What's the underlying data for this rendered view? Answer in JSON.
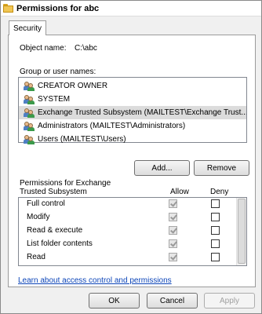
{
  "window": {
    "title": "Permissions for abc"
  },
  "tab": {
    "label": "Security"
  },
  "object": {
    "label": "Object name:",
    "value": "C:\\abc"
  },
  "group": {
    "label": "Group or user names:",
    "users": [
      {
        "name": "CREATOR OWNER"
      },
      {
        "name": "SYSTEM"
      },
      {
        "name": "Exchange Trusted Subsystem (MAILTEST\\Exchange Trust..."
      },
      {
        "name": "Administrators (MAILTEST\\Administrators)"
      },
      {
        "name": "Users (MAILTEST\\Users)"
      }
    ],
    "selected_index": 2
  },
  "buttons": {
    "add": "Add...",
    "remove": "Remove",
    "ok": "OK",
    "cancel": "Cancel",
    "apply": "Apply"
  },
  "permissions": {
    "label_line1": "Permissions for Exchange",
    "label_line2": "Trusted Subsystem",
    "allow_header": "Allow",
    "deny_header": "Deny",
    "rows": [
      {
        "name": "Full control",
        "allow": true,
        "deny": false
      },
      {
        "name": "Modify",
        "allow": true,
        "deny": false
      },
      {
        "name": "Read & execute",
        "allow": true,
        "deny": false
      },
      {
        "name": "List folder contents",
        "allow": true,
        "deny": false
      },
      {
        "name": "Read",
        "allow": true,
        "deny": false
      }
    ]
  },
  "link": {
    "text": "Learn about access control and permissions"
  },
  "colors": {
    "link": "#0b44b8",
    "selected_row": "#dcdcdc"
  },
  "icons": {
    "title": "folder-icon",
    "user": "users-icon"
  }
}
